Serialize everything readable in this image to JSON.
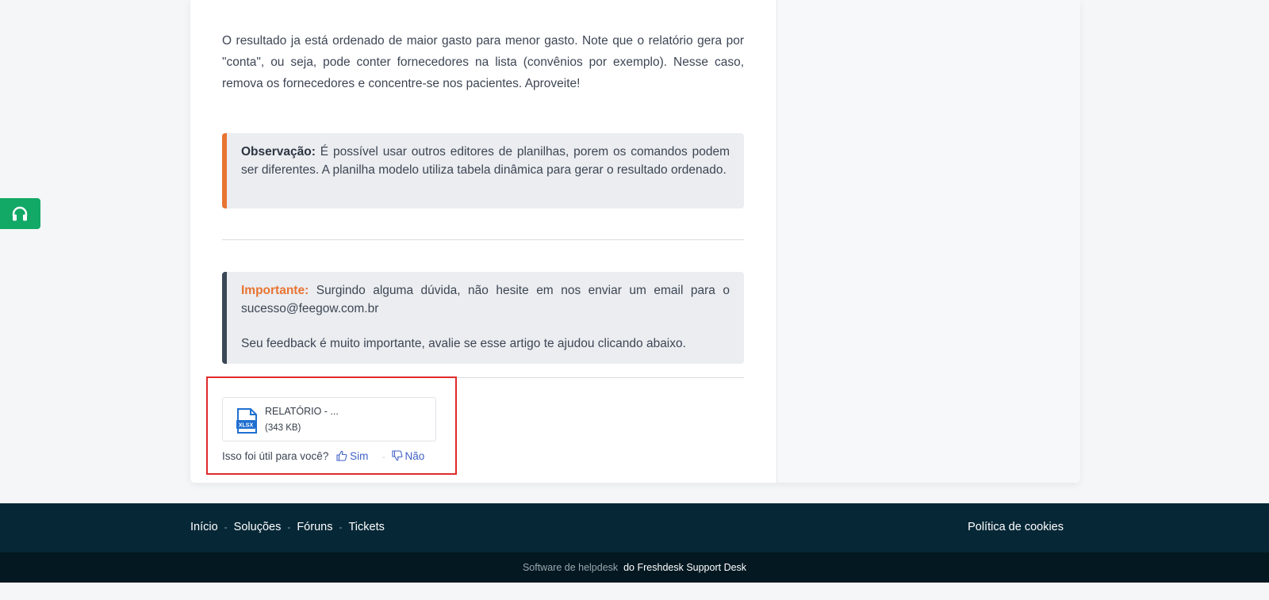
{
  "article": {
    "paragraph": "O resultado ja está ordenado de maior gasto para menor gasto. Note que o relatório gera por \"conta\", ou seja, pode conter fornecedores na lista (convênios por exemplo). Nesse caso, remova os fornecedores e concentre-se nos pacientes. Aproveite!",
    "note_label": "Observação:",
    "note_text": " É possível usar outros editores de planilhas, porem os comandos podem ser diferentes. A planilha modelo utiliza tabela dinâmica para gerar o resultado ordenado.",
    "important_label": "Importante:",
    "important_text": " Surgindo alguma dúvida, não hesite em nos enviar um email para o sucesso@feegow.com.br",
    "feedback_note": "Seu feedback é muito importante, avalie se esse artigo te ajudou clicando abaixo."
  },
  "attachment": {
    "name": "RELATÓRIO - ...",
    "size": "(343 KB)",
    "icon": "xlsx-file-icon",
    "icon_text": "XLSX"
  },
  "feedback": {
    "question": "Isso foi útil para você?",
    "yes": "Sim",
    "no": "Não",
    "separator": "-"
  },
  "support_tab": {
    "icon": "headset-icon"
  },
  "footer": {
    "nav": [
      "Início",
      "Soluções",
      "Fóruns",
      "Tickets"
    ],
    "separator": "-",
    "cookie_policy": "Política de cookies",
    "powered_prefix": "Software de helpdesk",
    "powered_suffix": "do Freshdesk Support Desk"
  },
  "colors": {
    "accent_orange": "#e87432",
    "support_green": "#12a866",
    "footer_bg": "#062736",
    "link_blue": "#4061c7",
    "highlight_red": "#e02a2a"
  }
}
